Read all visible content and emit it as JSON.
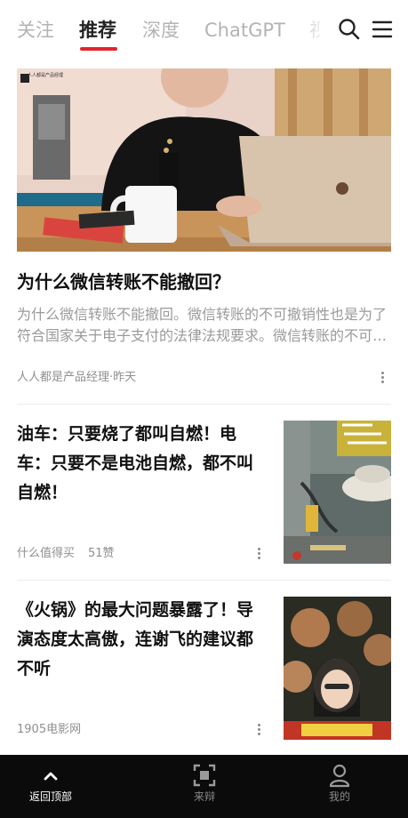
{
  "tabs": [
    {
      "label": "关注"
    },
    {
      "label": "推荐"
    },
    {
      "label": "深度"
    },
    {
      "label": "ChatGPT"
    },
    {
      "label": "视频"
    }
  ],
  "active_tab_index": 1,
  "colors": {
    "accent": "#e1252c",
    "bottom_bar": "#0b0b0b"
  },
  "top_icons": {
    "search": "search-icon",
    "menu": "menu-icon"
  },
  "articles": [
    {
      "title": "为什么微信转账不能撤回？",
      "summary": "为什么微信转账不能撤回。微信转账的不可撤销性也是为了符合国家关于电子支付的法律法规要求。微信转账的不可撤销性...",
      "source": "人人都是产品经理·昨天",
      "image_watermark": "人人都是产品经理"
    },
    {
      "title": "油车：只要烧了都叫自燃！电车：只要不是电池自燃，都不叫自燃！",
      "source": "什么值得买",
      "likes": "51赞"
    },
    {
      "title": "《火锅》的最大问题暴露了！导演态度太高傲，连谢飞的建议都不听",
      "source": "1905电影网"
    }
  ],
  "bottom_nav": [
    {
      "label": "返回顶部",
      "icon": "chevron-up-icon"
    },
    {
      "label": "来辩",
      "icon": "scan-frame-icon"
    },
    {
      "label": "我的",
      "icon": "person-icon"
    }
  ]
}
